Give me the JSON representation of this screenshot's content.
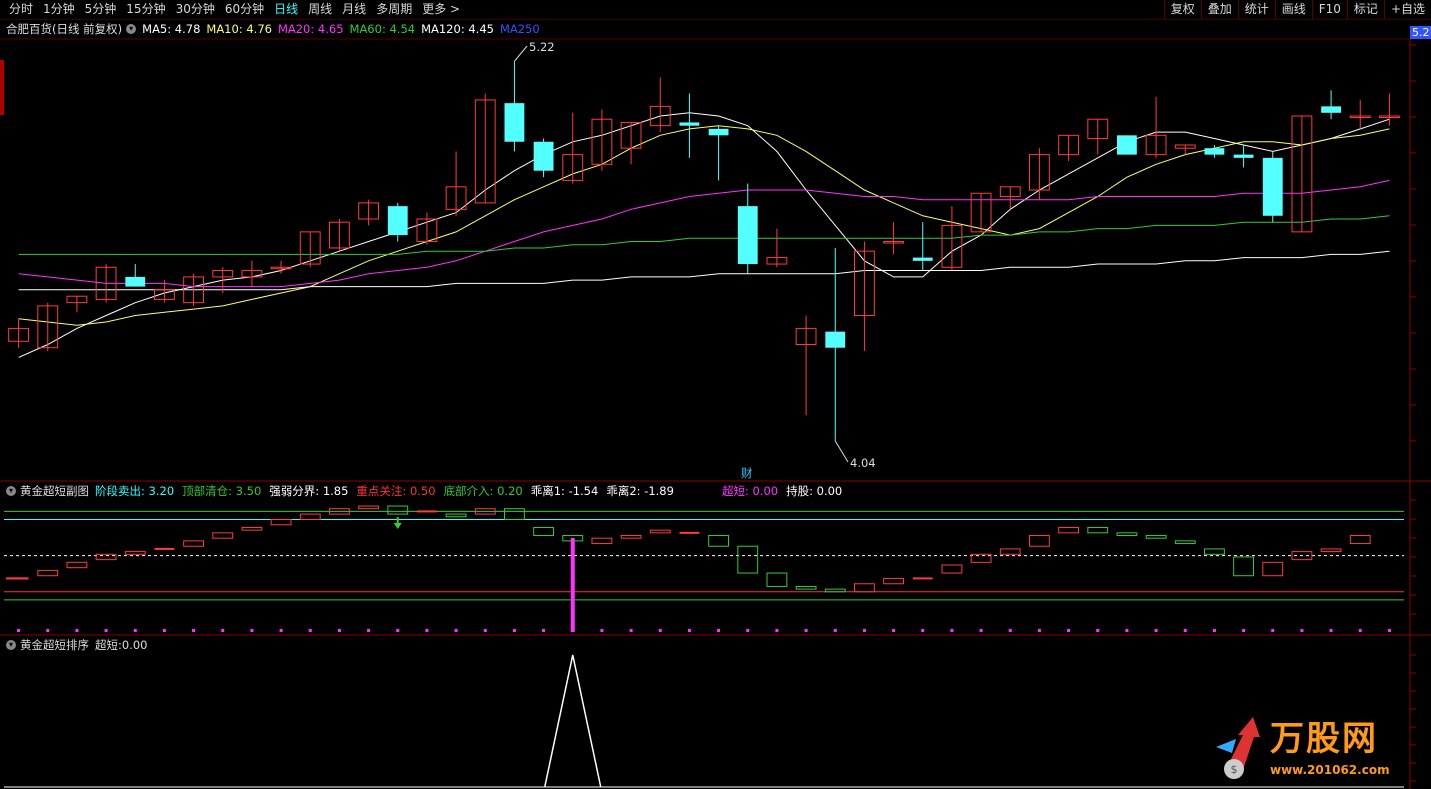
{
  "toolbar": {
    "periods": [
      "分时",
      "1分钟",
      "5分钟",
      "15分钟",
      "30分钟",
      "60分钟",
      "日线",
      "周线",
      "月线",
      "多周期",
      "更多 >"
    ],
    "active": "日线",
    "right_buttons": [
      "复权",
      "叠加",
      "统计",
      "画线",
      "F10",
      "标记",
      "+自选"
    ]
  },
  "stock": {
    "name": "合肥百货(日线 前复权)"
  },
  "ma_legend": [
    {
      "label": "MA5: 4.78",
      "color": "#ffffff"
    },
    {
      "label": "MA10: 4.76",
      "color": "#ffff66"
    },
    {
      "label": "MA20: 4.65",
      "color": "#ff33ff"
    },
    {
      "label": "MA60: 4.54",
      "color": "#33cc33"
    },
    {
      "label": "MA120: 4.45",
      "color": "#ffffff"
    },
    {
      "label": "MA250",
      "color": "#3355ff"
    }
  ],
  "price_tag": "5.21",
  "high_label": "5.22",
  "low_label": "4.04",
  "cai_label": "财",
  "indicator1": {
    "title": "黄金超短副图",
    "items": [
      {
        "label": "阶段卖出: ",
        "value": "3.20",
        "lc": "#33ffff",
        "vc": "#33ffff"
      },
      {
        "label": "顶部清仓: ",
        "value": "3.50",
        "lc": "#33cc33",
        "vc": "#33cc33"
      },
      {
        "label": "强弱分界: ",
        "value": "1.85",
        "lc": "#ffffff",
        "vc": "#ffffff"
      },
      {
        "label": "重点关注: ",
        "value": "0.50",
        "lc": "#ff3333",
        "vc": "#ff3333"
      },
      {
        "label": "底部介入: ",
        "value": "0.20",
        "lc": "#33cc33",
        "vc": "#33cc33"
      },
      {
        "label": "乖离1: ",
        "value": "-1.54",
        "lc": "#ffffff",
        "vc": "#ffffff"
      },
      {
        "label": "乖离2: ",
        "value": "-1.89",
        "lc": "#ffffff",
        "vc": "#ffffff"
      }
    ],
    "extra": [
      {
        "label": "超短: ",
        "value": "0.00",
        "lc": "#ff33ff",
        "vc": "#ff33ff"
      },
      {
        "label": "持股: ",
        "value": "0.00",
        "lc": "#ffffff",
        "vc": "#ffffff"
      }
    ]
  },
  "indicator2": {
    "title": "黄金超短排序",
    "items": [
      {
        "label": "超短: ",
        "value": "0.00"
      }
    ]
  },
  "watermark": {
    "brand": "万股网",
    "url": "www.201062.com"
  },
  "chart_data": {
    "type": "candlestick",
    "y_range": [
      3.95,
      5.28
    ],
    "candles": [
      {
        "o": 4.35,
        "h": 4.42,
        "l": 4.33,
        "c": 4.39
      },
      {
        "o": 4.33,
        "h": 4.47,
        "l": 4.32,
        "c": 4.46
      },
      {
        "o": 4.47,
        "h": 4.48,
        "l": 4.44,
        "c": 4.49
      },
      {
        "o": 4.48,
        "h": 4.59,
        "l": 4.47,
        "c": 4.58
      },
      {
        "o": 4.55,
        "h": 4.59,
        "l": 4.53,
        "c": 4.52
      },
      {
        "o": 4.48,
        "h": 4.54,
        "l": 4.47,
        "c": 4.51
      },
      {
        "o": 4.47,
        "h": 4.56,
        "l": 4.46,
        "c": 4.55
      },
      {
        "o": 4.55,
        "h": 4.58,
        "l": 4.5,
        "c": 4.57
      },
      {
        "o": 4.55,
        "h": 4.6,
        "l": 4.52,
        "c": 4.57
      },
      {
        "o": 4.58,
        "h": 4.6,
        "l": 4.56,
        "c": 4.58
      },
      {
        "o": 4.59,
        "h": 4.68,
        "l": 4.58,
        "c": 4.69
      },
      {
        "o": 4.64,
        "h": 4.73,
        "l": 4.63,
        "c": 4.72
      },
      {
        "o": 4.73,
        "h": 4.79,
        "l": 4.71,
        "c": 4.78
      },
      {
        "o": 4.77,
        "h": 4.78,
        "l": 4.66,
        "c": 4.68
      },
      {
        "o": 4.66,
        "h": 4.75,
        "l": 4.65,
        "c": 4.73
      },
      {
        "o": 4.76,
        "h": 4.94,
        "l": 4.74,
        "c": 4.83
      },
      {
        "o": 4.78,
        "h": 5.12,
        "l": 4.78,
        "c": 5.1
      },
      {
        "o": 5.09,
        "h": 5.22,
        "l": 4.94,
        "c": 4.97
      },
      {
        "o": 4.97,
        "h": 4.98,
        "l": 4.86,
        "c": 4.88
      },
      {
        "o": 4.85,
        "h": 5.06,
        "l": 4.84,
        "c": 4.93
      },
      {
        "o": 4.9,
        "h": 5.07,
        "l": 4.88,
        "c": 5.04
      },
      {
        "o": 4.95,
        "h": 5.03,
        "l": 4.9,
        "c": 5.03
      },
      {
        "o": 5.02,
        "h": 5.17,
        "l": 5.0,
        "c": 5.08
      },
      {
        "o": 5.03,
        "h": 5.12,
        "l": 4.92,
        "c": 5.02
      },
      {
        "o": 5.01,
        "h": 5.02,
        "l": 4.85,
        "c": 4.99
      },
      {
        "o": 4.77,
        "h": 4.84,
        "l": 4.56,
        "c": 4.59
      },
      {
        "o": 4.59,
        "h": 4.7,
        "l": 4.58,
        "c": 4.61
      },
      {
        "o": 4.34,
        "h": 4.43,
        "l": 4.12,
        "c": 4.39
      },
      {
        "o": 4.38,
        "h": 4.64,
        "l": 4.04,
        "c": 4.33
      },
      {
        "o": 4.43,
        "h": 4.66,
        "l": 4.32,
        "c": 4.63
      },
      {
        "o": 4.66,
        "h": 4.72,
        "l": 4.62,
        "c": 4.66
      },
      {
        "o": 4.61,
        "h": 4.72,
        "l": 4.57,
        "c": 4.6
      },
      {
        "o": 4.58,
        "h": 4.77,
        "l": 4.57,
        "c": 4.71
      },
      {
        "o": 4.69,
        "h": 4.8,
        "l": 4.69,
        "c": 4.81
      },
      {
        "o": 4.8,
        "h": 4.82,
        "l": 4.76,
        "c": 4.83
      },
      {
        "o": 4.82,
        "h": 4.95,
        "l": 4.79,
        "c": 4.93
      },
      {
        "o": 4.93,
        "h": 4.98,
        "l": 4.91,
        "c": 4.99
      },
      {
        "o": 4.98,
        "h": 5.01,
        "l": 4.93,
        "c": 5.04
      },
      {
        "o": 4.99,
        "h": 4.95,
        "l": 4.96,
        "c": 4.93
      },
      {
        "o": 4.93,
        "h": 5.11,
        "l": 4.92,
        "c": 4.99
      },
      {
        "o": 4.95,
        "h": 4.96,
        "l": 4.93,
        "c": 4.96
      },
      {
        "o": 4.95,
        "h": 4.96,
        "l": 4.92,
        "c": 4.93
      },
      {
        "o": 4.93,
        "h": 4.96,
        "l": 4.89,
        "c": 4.92
      },
      {
        "o": 4.92,
        "h": 4.94,
        "l": 4.72,
        "c": 4.74
      },
      {
        "o": 4.69,
        "h": 5.03,
        "l": 4.69,
        "c": 5.05
      },
      {
        "o": 5.08,
        "h": 5.13,
        "l": 5.04,
        "c": 5.06
      },
      {
        "o": 5.05,
        "h": 5.1,
        "l": 5.01,
        "c": 5.05
      },
      {
        "o": 5.05,
        "h": 5.12,
        "l": 5.02,
        "c": 5.05
      }
    ],
    "ma_lines": [
      {
        "name": "MA5",
        "color": "#ffffff",
        "values": [
          4.3,
          4.34,
          4.39,
          4.43,
          4.47,
          4.5,
          4.52,
          4.54,
          4.55,
          4.57,
          4.6,
          4.63,
          4.66,
          4.69,
          4.72,
          4.75,
          4.82,
          4.88,
          4.93,
          4.97,
          4.99,
          5.02,
          5.05,
          5.06,
          5.05,
          5.02,
          4.94,
          4.82,
          4.71,
          4.6,
          4.55,
          4.55,
          4.63,
          4.68,
          4.76,
          4.82,
          4.87,
          4.92,
          4.97,
          5.0,
          5.0,
          4.98,
          4.96,
          4.94,
          4.96,
          4.98,
          5.01,
          5.04
        ]
      },
      {
        "name": "MA10",
        "color": "#ffff66",
        "values": [
          4.42,
          4.41,
          4.4,
          4.41,
          4.43,
          4.44,
          4.45,
          4.46,
          4.48,
          4.5,
          4.52,
          4.56,
          4.6,
          4.63,
          4.66,
          4.69,
          4.74,
          4.79,
          4.83,
          4.87,
          4.9,
          4.95,
          4.99,
          5.01,
          5.02,
          5.01,
          4.99,
          4.94,
          4.88,
          4.82,
          4.78,
          4.74,
          4.72,
          4.7,
          4.68,
          4.7,
          4.75,
          4.8,
          4.86,
          4.9,
          4.93,
          4.95,
          4.97,
          4.97,
          4.96,
          4.98,
          4.99,
          5.01
        ]
      },
      {
        "name": "MA20",
        "color": "#ff33ff",
        "values": [
          4.56,
          4.55,
          4.54,
          4.53,
          4.53,
          4.53,
          4.52,
          4.52,
          4.52,
          4.52,
          4.53,
          4.54,
          4.56,
          4.57,
          4.58,
          4.6,
          4.63,
          4.66,
          4.69,
          4.71,
          4.73,
          4.76,
          4.78,
          4.8,
          4.81,
          4.82,
          4.82,
          4.82,
          4.81,
          4.8,
          4.8,
          4.79,
          4.79,
          4.79,
          4.79,
          4.79,
          4.79,
          4.8,
          4.8,
          4.8,
          4.8,
          4.8,
          4.81,
          4.81,
          4.81,
          4.82,
          4.83,
          4.85
        ]
      },
      {
        "name": "MA60",
        "color": "#33cc33",
        "values": [
          4.62,
          4.62,
          4.62,
          4.62,
          4.62,
          4.62,
          4.62,
          4.62,
          4.62,
          4.62,
          4.62,
          4.62,
          4.62,
          4.62,
          4.63,
          4.63,
          4.63,
          4.64,
          4.64,
          4.65,
          4.65,
          4.66,
          4.66,
          4.67,
          4.67,
          4.67,
          4.67,
          4.67,
          4.67,
          4.67,
          4.67,
          4.67,
          4.67,
          4.68,
          4.68,
          4.69,
          4.69,
          4.7,
          4.7,
          4.71,
          4.71,
          4.71,
          4.72,
          4.72,
          4.72,
          4.73,
          4.73,
          4.74
        ]
      },
      {
        "name": "MA120",
        "color": "#ffffff",
        "values": [
          4.51,
          4.51,
          4.51,
          4.51,
          4.51,
          4.51,
          4.51,
          4.51,
          4.51,
          4.51,
          4.52,
          4.52,
          4.52,
          4.52,
          4.52,
          4.53,
          4.53,
          4.53,
          4.53,
          4.54,
          4.54,
          4.55,
          4.55,
          4.55,
          4.56,
          4.56,
          4.56,
          4.56,
          4.56,
          4.57,
          4.57,
          4.57,
          4.57,
          4.57,
          4.58,
          4.58,
          4.58,
          4.59,
          4.59,
          4.59,
          4.6,
          4.6,
          4.61,
          4.61,
          4.61,
          4.62,
          4.62,
          4.63
        ]
      }
    ],
    "indicator1_range": [
      -1.0,
      4.0
    ],
    "indicator1_bars": [
      {
        "o": 1.0,
        "c": 1.0
      },
      {
        "o": 1.1,
        "c": 1.3
      },
      {
        "o": 1.4,
        "c": 1.6
      },
      {
        "o": 1.7,
        "c": 1.9
      },
      {
        "o": 1.9,
        "c": 2.0
      },
      {
        "o": 2.1,
        "c": 2.1
      },
      {
        "o": 2.2,
        "c": 2.4
      },
      {
        "o": 2.5,
        "c": 2.7
      },
      {
        "o": 2.8,
        "c": 2.9
      },
      {
        "o": 3.0,
        "c": 3.2
      },
      {
        "o": 3.2,
        "c": 3.4
      },
      {
        "o": 3.4,
        "c": 3.6
      },
      {
        "o": 3.6,
        "c": 3.7
      },
      {
        "o": 3.7,
        "c": 3.4
      },
      {
        "o": 3.5,
        "c": 3.5
      },
      {
        "o": 3.4,
        "c": 3.3
      },
      {
        "o": 3.4,
        "c": 3.6
      },
      {
        "o": 3.6,
        "c": 3.2
      },
      {
        "o": 2.9,
        "c": 2.6
      },
      {
        "o": 2.6,
        "c": 2.4
      },
      {
        "o": 2.3,
        "c": 2.5
      },
      {
        "o": 2.5,
        "c": 2.6
      },
      {
        "o": 2.7,
        "c": 2.8
      },
      {
        "o": 2.7,
        "c": 2.7
      },
      {
        "o": 2.6,
        "c": 2.2
      },
      {
        "o": 2.2,
        "c": 1.2
      },
      {
        "o": 1.2,
        "c": 0.7
      },
      {
        "o": 0.7,
        "c": 0.6
      },
      {
        "o": 0.6,
        "c": 0.5
      },
      {
        "o": 0.5,
        "c": 0.8
      },
      {
        "o": 0.8,
        "c": 1.0
      },
      {
        "o": 1.0,
        "c": 1.0
      },
      {
        "o": 1.2,
        "c": 1.5
      },
      {
        "o": 1.6,
        "c": 1.9
      },
      {
        "o": 1.9,
        "c": 2.1
      },
      {
        "o": 2.2,
        "c": 2.6
      },
      {
        "o": 2.7,
        "c": 2.9
      },
      {
        "o": 2.9,
        "c": 2.7
      },
      {
        "o": 2.7,
        "c": 2.6
      },
      {
        "o": 2.6,
        "c": 2.5
      },
      {
        "o": 2.4,
        "c": 2.3
      },
      {
        "o": 2.1,
        "c": 1.9
      },
      {
        "o": 1.8,
        "c": 1.1
      },
      {
        "o": 1.1,
        "c": 1.6
      },
      {
        "o": 1.7,
        "c": 2.0
      },
      {
        "o": 2.0,
        "c": 2.1
      },
      {
        "o": 2.3,
        "c": 2.6
      }
    ],
    "indicator1_levels": [
      {
        "name": "阶段卖出",
        "value": 3.2,
        "color": "#33ffff",
        "dashed": false
      },
      {
        "name": "顶部清仓",
        "value": 3.5,
        "color": "#33cc33",
        "dashed": false
      },
      {
        "name": "强弱分界",
        "value": 1.85,
        "color": "#ffffff",
        "dashed": true
      },
      {
        "name": "重点关注",
        "value": 0.5,
        "color": "#ff3333",
        "dashed": false
      },
      {
        "name": "底部介入",
        "value": 0.2,
        "color": "#33cc33",
        "dashed": false
      }
    ],
    "spike_index": 19,
    "sell_arrow_index": 13,
    "indicator2_peak_index": 19
  }
}
